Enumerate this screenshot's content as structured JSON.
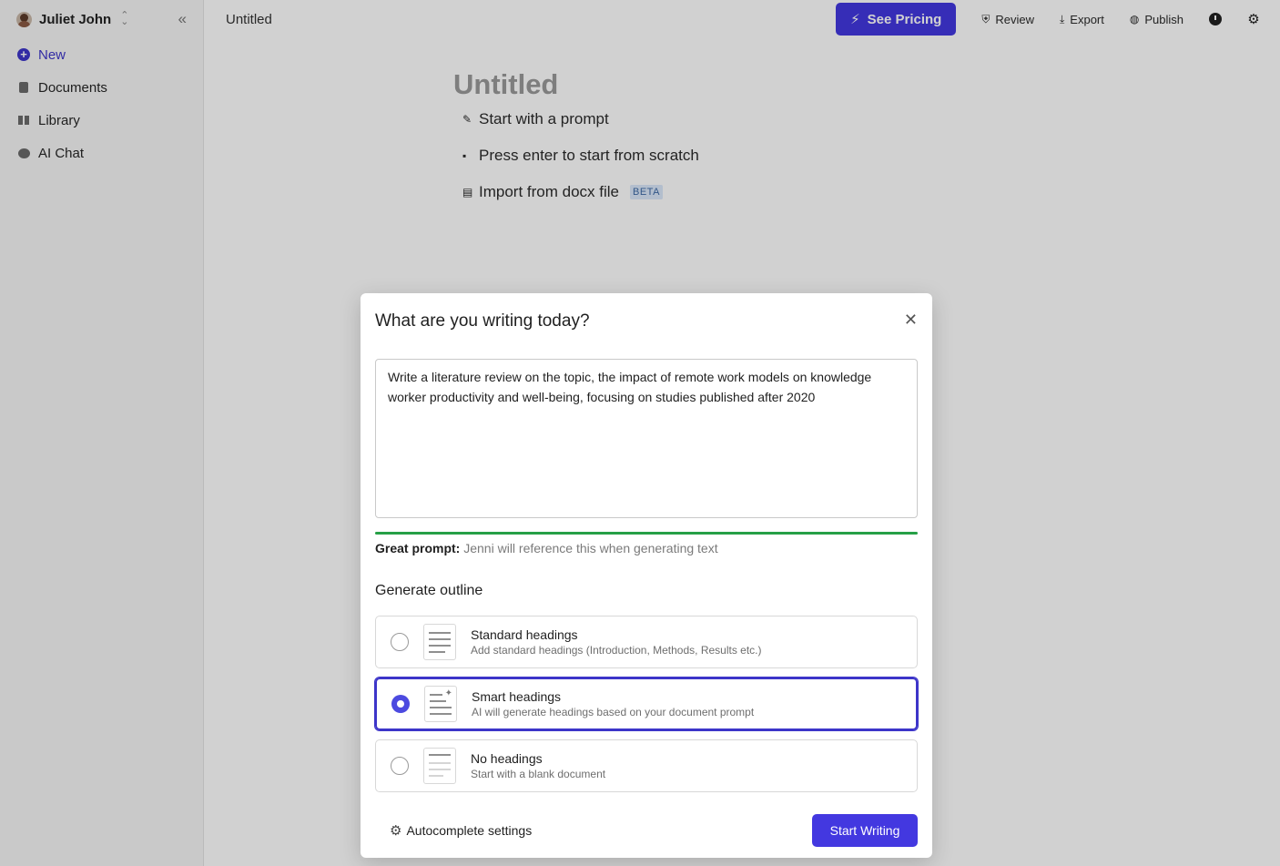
{
  "sidebar": {
    "user_name": "Juliet John",
    "items": [
      {
        "label": "New",
        "icon": "plus-circle-icon",
        "active": true
      },
      {
        "label": "Documents",
        "icon": "document-icon"
      },
      {
        "label": "Library",
        "icon": "library-icon"
      },
      {
        "label": "AI Chat",
        "icon": "chat-icon"
      }
    ]
  },
  "topbar": {
    "doc_title": "Untitled",
    "pricing_label": "See Pricing",
    "review_label": "Review",
    "export_label": "Export",
    "publish_label": "Publish"
  },
  "editor": {
    "title_placeholder": "Untitled",
    "options": [
      {
        "label": "Start with a prompt",
        "icon": "edit-icon"
      },
      {
        "label": "Press enter to start from scratch",
        "icon": "document-icon"
      },
      {
        "label": "Import from docx file",
        "icon": "docx-icon",
        "badge": "BETA"
      }
    ]
  },
  "modal": {
    "title": "What are you writing today?",
    "prompt_value": "Write a literature review on the topic, the impact of remote work models on knowledge worker productivity and well-being, focusing on studies published after 2020",
    "prompt_quality_label": "Great prompt:",
    "prompt_quality_hint": "Jenni will reference this when generating text",
    "prompt_quality_percent": 100,
    "outline_label": "Generate outline",
    "outline_options": [
      {
        "title": "Standard headings",
        "subtitle": "Add standard headings (Introduction, Methods, Results etc.)",
        "selected": false
      },
      {
        "title": "Smart headings",
        "subtitle": "AI will generate headings based on your document prompt",
        "selected": true
      },
      {
        "title": "No headings",
        "subtitle": "Start with a blank document",
        "selected": false
      }
    ],
    "autocomplete_label": "Autocomplete settings",
    "start_label": "Start Writing"
  },
  "colors": {
    "accent": "#4338e0",
    "success": "#26a046",
    "selected_border": "#3d35c9"
  }
}
